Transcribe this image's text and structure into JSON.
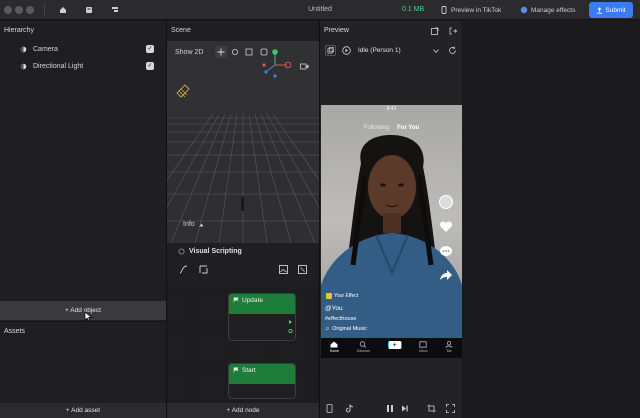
{
  "titlebar": {
    "title": "Untitled",
    "size": "0.1 MB",
    "preview_tiktok": "Preview in TikTok",
    "manage_effects": "Manage effects",
    "submit": "Submit"
  },
  "hierarchy": {
    "title": "Hierarchy",
    "items": [
      {
        "label": "Camera",
        "checked": true
      },
      {
        "label": "Directional Light",
        "checked": true
      }
    ],
    "add_button": "+ Add object"
  },
  "assets": {
    "title": "Assets",
    "add_button": "+ Add asset"
  },
  "scene": {
    "title": "Scene",
    "show2d": "Show 2D",
    "info": "Info"
  },
  "visual_scripting": {
    "title": "Visual Scripting",
    "nodes": [
      {
        "label": "Update"
      },
      {
        "label": "Start"
      }
    ],
    "add_button": "+ Add node"
  },
  "preview": {
    "title": "Preview",
    "dropdown": "Idle (Person 1)",
    "phone": {
      "time": "9:41",
      "tab_following": "Following",
      "tab_for_you": "For You",
      "your_effect": "Your Effect",
      "user": "@You",
      "hashtag": "#effecthouse",
      "sound": "Original Music",
      "nav": [
        "Home",
        "Discover",
        "",
        "Inbox",
        "Me"
      ]
    }
  },
  "colors": {
    "accent": "#3a7cf0",
    "size_green": "#4fd18b",
    "node_green": "#1e7d3a"
  }
}
